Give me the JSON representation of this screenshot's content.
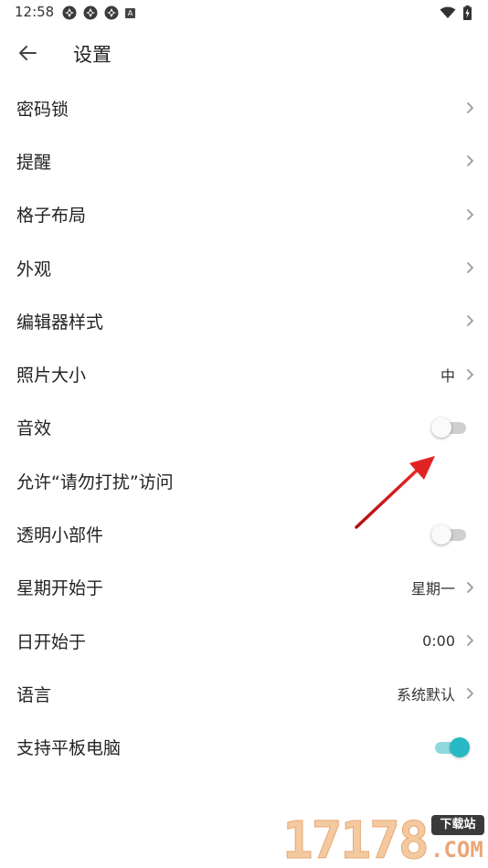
{
  "status_bar": {
    "time": "12:58",
    "notification_icons": [
      "settings-cog-icon",
      "settings-cog-icon",
      "settings-cog-icon",
      "a-letter-icon"
    ],
    "a_badge": "A",
    "right_icons": [
      "wifi-icon",
      "battery-charging-icon"
    ]
  },
  "header": {
    "title": "设置",
    "back_icon": "arrow-left-icon"
  },
  "settings": {
    "items": [
      {
        "label": "密码锁",
        "type": "nav"
      },
      {
        "label": "提醒",
        "type": "nav"
      },
      {
        "label": "格子布局",
        "type": "nav"
      },
      {
        "label": "外观",
        "type": "nav"
      },
      {
        "label": "编辑器样式",
        "type": "nav"
      },
      {
        "label": "照片大小",
        "type": "nav",
        "value": "中"
      },
      {
        "label": "音效",
        "type": "toggle",
        "on": false
      },
      {
        "label": "允许“请勿打扰”访问",
        "type": "plain"
      },
      {
        "label": "透明小部件",
        "type": "toggle",
        "on": false
      },
      {
        "label": "星期开始于",
        "type": "nav",
        "value": "星期一"
      },
      {
        "label": "日开始于",
        "type": "nav",
        "value": "0:00"
      },
      {
        "label": "语言",
        "type": "nav",
        "value": "系统默认"
      },
      {
        "label": "支持平板电脑",
        "type": "toggle",
        "on": true
      }
    ]
  },
  "watermark": {
    "digits": "17178",
    "badge": "下载站",
    "domain": ".COM"
  },
  "colors": {
    "accent": "#26b9c4",
    "accent_track": "#8fd9dd",
    "toggle_off_track": "#cfcfcf",
    "annotation_arrow": "#d62020",
    "chevron": "#9a9a9a"
  }
}
